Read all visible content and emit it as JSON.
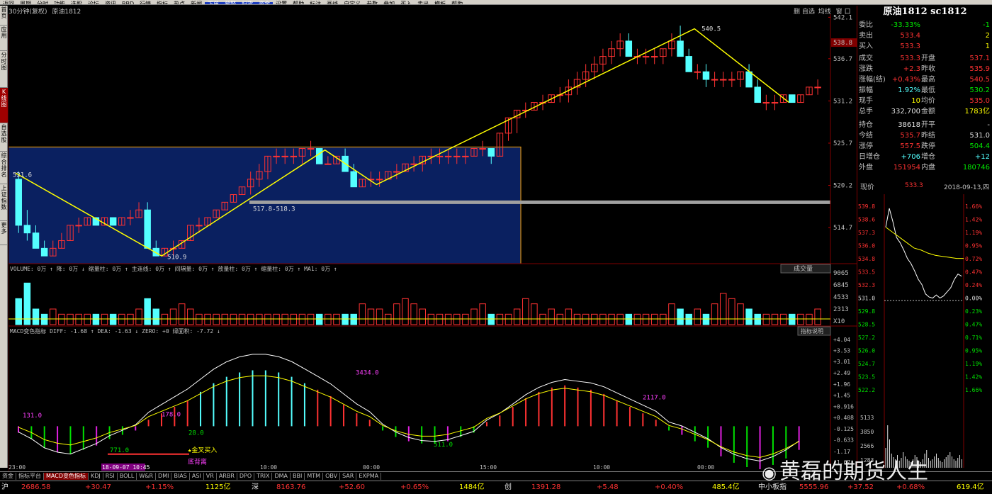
{
  "topbar": [
    "返回",
    "周期",
    "分时",
    "功能",
    "选股",
    "论坛",
    "资讯",
    "BBD",
    "行情",
    "指标",
    "热点",
    "新闻",
    "下单",
    "预警",
    "扫货",
    "资金",
    "设置",
    "帮助",
    "标注",
    "画线",
    "自定义",
    "参数",
    "叠加",
    "买入",
    "卖出",
    "模板",
    "帮助"
  ],
  "left_tabs": [
    "首页",
    "应用",
    "分时图",
    "K线图",
    "自选股",
    "综合排名",
    "上证指数",
    "更多"
  ],
  "chart_header": {
    "period": "30分钟(复权)",
    "symbol": "原油1812"
  },
  "chart_tools": {
    "t1": "删",
    "t2": "自选",
    "t3": "均线",
    "t4": "窗",
    "t5": "口"
  },
  "colors": {
    "up": "#ff3232",
    "down": "#54ffff",
    "ma": "#ffff00",
    "box": "#0a2060",
    "box_border": "#ffa500"
  },
  "kline": {
    "yticks": [
      "542.1",
      "536.7",
      "531.2",
      "525.7",
      "520.2",
      "514.7"
    ],
    "price_tag": "538.8",
    "annotations": {
      "left_high": "521.6",
      "low": "510.9",
      "range": "517.8-518.3",
      "high": "540.5"
    },
    "candles": [
      [
        521,
        522,
        514,
        515
      ],
      [
        515,
        517,
        513,
        514
      ],
      [
        514,
        515,
        512,
        512
      ],
      [
        512,
        513,
        511,
        511
      ],
      [
        511,
        513,
        511,
        512
      ],
      [
        512,
        514,
        512,
        513
      ],
      [
        513,
        515,
        513,
        515
      ],
      [
        515,
        516,
        514,
        515
      ],
      [
        515,
        516,
        515,
        516
      ],
      [
        516,
        516,
        515,
        515
      ],
      [
        515,
        516,
        515,
        516
      ],
      [
        516,
        516,
        515,
        515
      ],
      [
        515,
        516,
        515,
        516
      ],
      [
        516,
        517,
        515,
        516
      ],
      [
        516,
        518,
        516,
        517
      ],
      [
        517,
        518,
        512,
        512
      ],
      [
        512,
        513,
        511,
        511
      ],
      [
        511,
        512,
        511,
        512
      ],
      [
        512,
        513,
        511,
        512
      ],
      [
        512,
        513,
        512,
        513
      ],
      [
        513,
        515,
        513,
        515
      ],
      [
        515,
        516,
        514,
        515
      ],
      [
        515,
        516,
        515,
        516
      ],
      [
        516,
        517,
        516,
        517
      ],
      [
        517,
        518,
        517,
        518
      ],
      [
        518,
        519,
        518,
        519
      ],
      [
        519,
        520,
        519,
        520
      ],
      [
        520,
        522,
        519,
        521
      ],
      [
        521,
        523,
        520,
        522
      ],
      [
        522,
        524,
        521,
        524
      ],
      [
        524,
        525,
        523,
        524
      ],
      [
        524,
        525,
        523,
        524
      ],
      [
        524,
        525,
        523,
        524
      ],
      [
        524,
        525,
        523,
        525
      ],
      [
        525,
        526,
        524,
        525
      ],
      [
        525,
        525,
        523,
        523
      ],
      [
        523,
        524,
        523,
        523
      ],
      [
        523,
        524,
        523,
        524
      ],
      [
        524,
        525,
        522,
        522
      ],
      [
        522,
        523,
        520,
        520
      ],
      [
        520,
        521,
        520,
        521
      ],
      [
        521,
        522,
        520,
        521
      ],
      [
        521,
        522,
        520,
        521
      ],
      [
        521,
        522,
        521,
        522
      ],
      [
        522,
        523,
        521,
        522
      ],
      [
        522,
        523,
        522,
        523
      ],
      [
        523,
        524,
        522,
        523
      ],
      [
        523,
        524,
        522,
        524
      ],
      [
        524,
        525,
        523,
        524
      ],
      [
        524,
        525,
        523,
        524
      ],
      [
        524,
        525,
        523,
        524
      ],
      [
        524,
        525,
        523,
        524
      ],
      [
        524,
        525,
        523,
        524
      ],
      [
        524,
        525,
        524,
        525
      ],
      [
        525,
        526,
        524,
        525
      ],
      [
        525,
        525,
        523,
        524
      ],
      [
        524,
        527,
        524,
        527
      ],
      [
        527,
        529,
        526,
        529
      ],
      [
        529,
        530,
        527,
        530
      ],
      [
        530,
        531,
        529,
        530
      ],
      [
        530,
        531,
        530,
        531
      ],
      [
        531,
        532,
        530,
        531
      ],
      [
        531,
        532,
        531,
        532
      ],
      [
        532,
        533,
        531,
        532
      ],
      [
        532,
        534,
        531,
        533
      ],
      [
        533,
        535,
        532,
        534
      ],
      [
        534,
        536,
        533,
        535
      ],
      [
        535,
        537,
        534,
        536
      ],
      [
        536,
        538,
        535,
        537
      ],
      [
        537,
        539,
        536,
        538
      ],
      [
        538,
        540,
        537,
        539
      ],
      [
        539,
        540,
        537,
        537
      ],
      [
        537,
        538,
        536,
        537
      ],
      [
        537,
        538,
        536,
        537
      ],
      [
        537,
        538,
        536,
        537
      ],
      [
        537,
        538,
        536,
        538
      ],
      [
        538,
        540,
        537,
        539
      ],
      [
        539,
        541,
        537,
        537
      ],
      [
        537,
        538,
        535,
        535
      ],
      [
        535,
        536,
        534,
        535
      ],
      [
        535,
        536,
        533,
        534
      ],
      [
        534,
        535,
        533,
        534
      ],
      [
        534,
        535,
        533,
        534
      ],
      [
        534,
        535,
        533,
        534
      ],
      [
        534,
        535,
        533,
        535
      ],
      [
        535,
        536,
        533,
        533
      ],
      [
        533,
        534,
        531,
        531
      ],
      [
        531,
        532,
        530,
        531
      ],
      [
        531,
        532,
        530,
        531
      ],
      [
        531,
        532,
        531,
        532
      ],
      [
        532,
        532,
        531,
        531
      ],
      [
        531,
        532,
        531,
        532
      ],
      [
        532,
        533,
        532,
        533
      ],
      [
        533,
        534,
        532,
        533
      ]
    ]
  },
  "volume": {
    "label": "VOLUME: 0万 ↑ 降: 0万 ↓ 缩量柱: 0万 ↑ 主连线: 0万 ↑ 间隔量: 0万 ↑ 放量柱: 0万 ↑ 缩量柱: 0万 ↑ MA1: 0万 ↑",
    "yticks": [
      "9065",
      "6845",
      "4533",
      "2313",
      "X10"
    ],
    "button": "成交量",
    "bars": [
      5,
      8,
      3,
      2,
      3,
      2,
      2,
      2,
      2,
      2,
      2,
      2,
      2,
      2,
      3,
      5,
      3,
      2,
      3,
      4,
      3,
      2,
      2,
      2,
      2,
      2,
      2,
      2,
      2,
      2,
      2,
      2,
      2,
      2,
      2,
      2,
      2,
      2,
      2,
      2,
      4,
      3,
      3,
      2,
      4,
      5,
      4,
      3,
      2,
      2,
      2,
      2,
      2,
      3,
      4,
      2,
      2,
      2,
      3,
      5,
      4,
      2,
      3,
      2,
      3,
      2,
      2,
      2,
      2,
      2,
      2,
      2,
      2,
      2,
      2,
      2,
      4,
      3,
      2,
      3,
      2,
      4,
      6,
      5,
      4,
      3,
      2,
      2,
      2,
      2,
      2,
      2,
      2,
      3
    ]
  },
  "macd": {
    "label": "MACD变色指标  DIFF: -1.68 ↑  DEA: -1.63 ↓  ZERO: +0  绿面积: -7.72 ↓",
    "button": "指标说明",
    "yticks": [
      "+4.04",
      "+3.53",
      "+3.01",
      "+2.49",
      "+1.96",
      "+1.45",
      "+0.916",
      "+0.408",
      "-0.125",
      "-0.633",
      "-1.17",
      "-1.67"
    ],
    "labels": {
      "a": "131.0",
      "b": "178.0",
      "c": "28.0",
      "d": "771.0",
      "e": "3434.0",
      "f": "511.0",
      "g": "2117.0",
      "buy": "★金叉买入",
      "note": "底背离"
    },
    "hist": [
      -0.3,
      -0.6,
      -1.0,
      -1.2,
      -1.3,
      -1.1,
      -0.9,
      -0.6,
      -0.4,
      -0.2,
      0.3,
      0.6,
      0.9,
      1.2,
      1.6,
      2.0,
      2.3,
      2.5,
      2.6,
      2.6,
      2.5,
      2.3,
      2.0,
      1.7,
      1.4,
      1.0,
      0.6,
      0.3,
      -0.2,
      -0.5,
      -0.7,
      -0.8,
      -0.8,
      -0.7,
      -0.5,
      -0.3,
      0.2,
      0.5,
      0.9,
      1.3,
      1.6,
      1.8,
      1.9,
      1.8,
      1.7,
      1.5,
      1.2,
      0.9,
      0.6,
      0.3,
      -0.2,
      -0.4,
      -0.7,
      -1.0,
      -1.4,
      -1.7,
      -1.9,
      -2.0,
      -1.8,
      -1.5,
      -1.1
    ]
  },
  "xaxis": [
    "23:00",
    "10:00",
    "00:00",
    "15:00",
    "10:00",
    "00:00"
  ],
  "date_tag": "18-09-07 10:45",
  "right_panel": {
    "title": "原油1812 sc1812",
    "rows": [
      {
        "l1": "委比",
        "v1": "-33.33%",
        "c1": "grn",
        "l2": "",
        "v2": "-1",
        "c2": "grn"
      },
      {
        "l1": "卖出",
        "v1": "533.4",
        "c1": "red",
        "l2": "",
        "v2": "2",
        "c2": "yel"
      },
      {
        "l1": "买入",
        "v1": "533.3",
        "c1": "red",
        "l2": "",
        "v2": "1",
        "c2": "yel"
      },
      {
        "l1": "成交",
        "v1": "533.3",
        "c1": "red",
        "l2": "开盘",
        "v2": "537.1",
        "c2": "red"
      },
      {
        "l1": "涨跌",
        "v1": "+2.3",
        "c1": "red",
        "l2": "昨收",
        "v2": "535.9",
        "c2": "red"
      },
      {
        "l1": "涨幅(结)",
        "v1": "+0.43%",
        "c1": "red",
        "l2": "最高",
        "v2": "540.5",
        "c2": "red"
      },
      {
        "l1": "振幅",
        "v1": "1.92%",
        "c1": "cyn",
        "l2": "最低",
        "v2": "530.2",
        "c2": "grn"
      },
      {
        "l1": "现手",
        "v1": "10",
        "c1": "yel",
        "l2": "均价",
        "v2": "535.0",
        "c2": "red"
      },
      {
        "l1": "总手",
        "v1": "332,700",
        "c1": "wht",
        "l2": "金额",
        "v2": "1783亿",
        "c2": "yel"
      },
      {
        "l1": "持仓",
        "v1": "38618",
        "c1": "wht",
        "l2": "开平",
        "v2": "-",
        "c2": "wht"
      },
      {
        "l1": "今结",
        "v1": "535.7",
        "c1": "red",
        "l2": "昨结",
        "v2": "531.0",
        "c2": "wht"
      },
      {
        "l1": "涨停",
        "v1": "557.5",
        "c1": "red",
        "l2": "跌停",
        "v2": "504.4",
        "c2": "grn"
      },
      {
        "l1": "日增仓",
        "v1": "+706",
        "c1": "cyn",
        "l2": "增仓",
        "v2": "+12",
        "c2": "cyn"
      },
      {
        "l1": "外盘",
        "v1": "151954",
        "c1": "red",
        "l2": "内盘",
        "v2": "180746",
        "c2": "grn"
      }
    ],
    "mini_label": "现价",
    "mini_price": "533.3",
    "mini_date": "2018-09-13,四",
    "mini_yticks": [
      "539.8",
      "538.6",
      "537.3",
      "536.0",
      "534.8",
      "533.5",
      "532.3",
      "531.0",
      "529.8",
      "528.5",
      "527.2",
      "526.0",
      "524.7",
      "523.5",
      "522.2"
    ],
    "mini_pct": [
      "1.66%",
      "1.42%",
      "1.19%",
      "0.95%",
      "0.72%",
      "0.47%",
      "0.24%",
      "0.00%",
      "0.23%",
      "0.47%",
      "0.71%",
      "0.95%",
      "1.19%",
      "1.42%",
      "1.66%"
    ],
    "mini_vol": [
      "5133",
      "3850",
      "2566",
      "1283"
    ]
  },
  "bottom_tabs": [
    "资金",
    "指标平台",
    "MACD变色指标",
    "KDJ",
    "RSI",
    "BOLL",
    "W&R",
    "DMI",
    "BIAS",
    "ASI",
    "VR",
    "ARBR",
    "DPO",
    "TRIX",
    "DMA",
    "BBI",
    "MTM",
    "OBV",
    "SAR",
    "EXPMA"
  ],
  "status": {
    "s1": "沪",
    "s1v": "2686.58",
    "s1c": "+30.47",
    "s1p": "+1.15%",
    "s1a": "1125亿",
    "s2": "深",
    "s2v": "8163.76",
    "s2c": "+52.60",
    "s2p": "+0.65%",
    "s2a": "1484亿",
    "s3": "创",
    "s3v": "1391.28",
    "s3c": "+5.48",
    "s3p": "+0.40%",
    "s3a": "485.4亿",
    "s4": "中小板指",
    "s4v": "5555.96",
    "s4c": "+37.52",
    "s4p": "+0.68%",
    "s4a": "619.4亿"
  },
  "watermark": "黄磊的期货人生"
}
